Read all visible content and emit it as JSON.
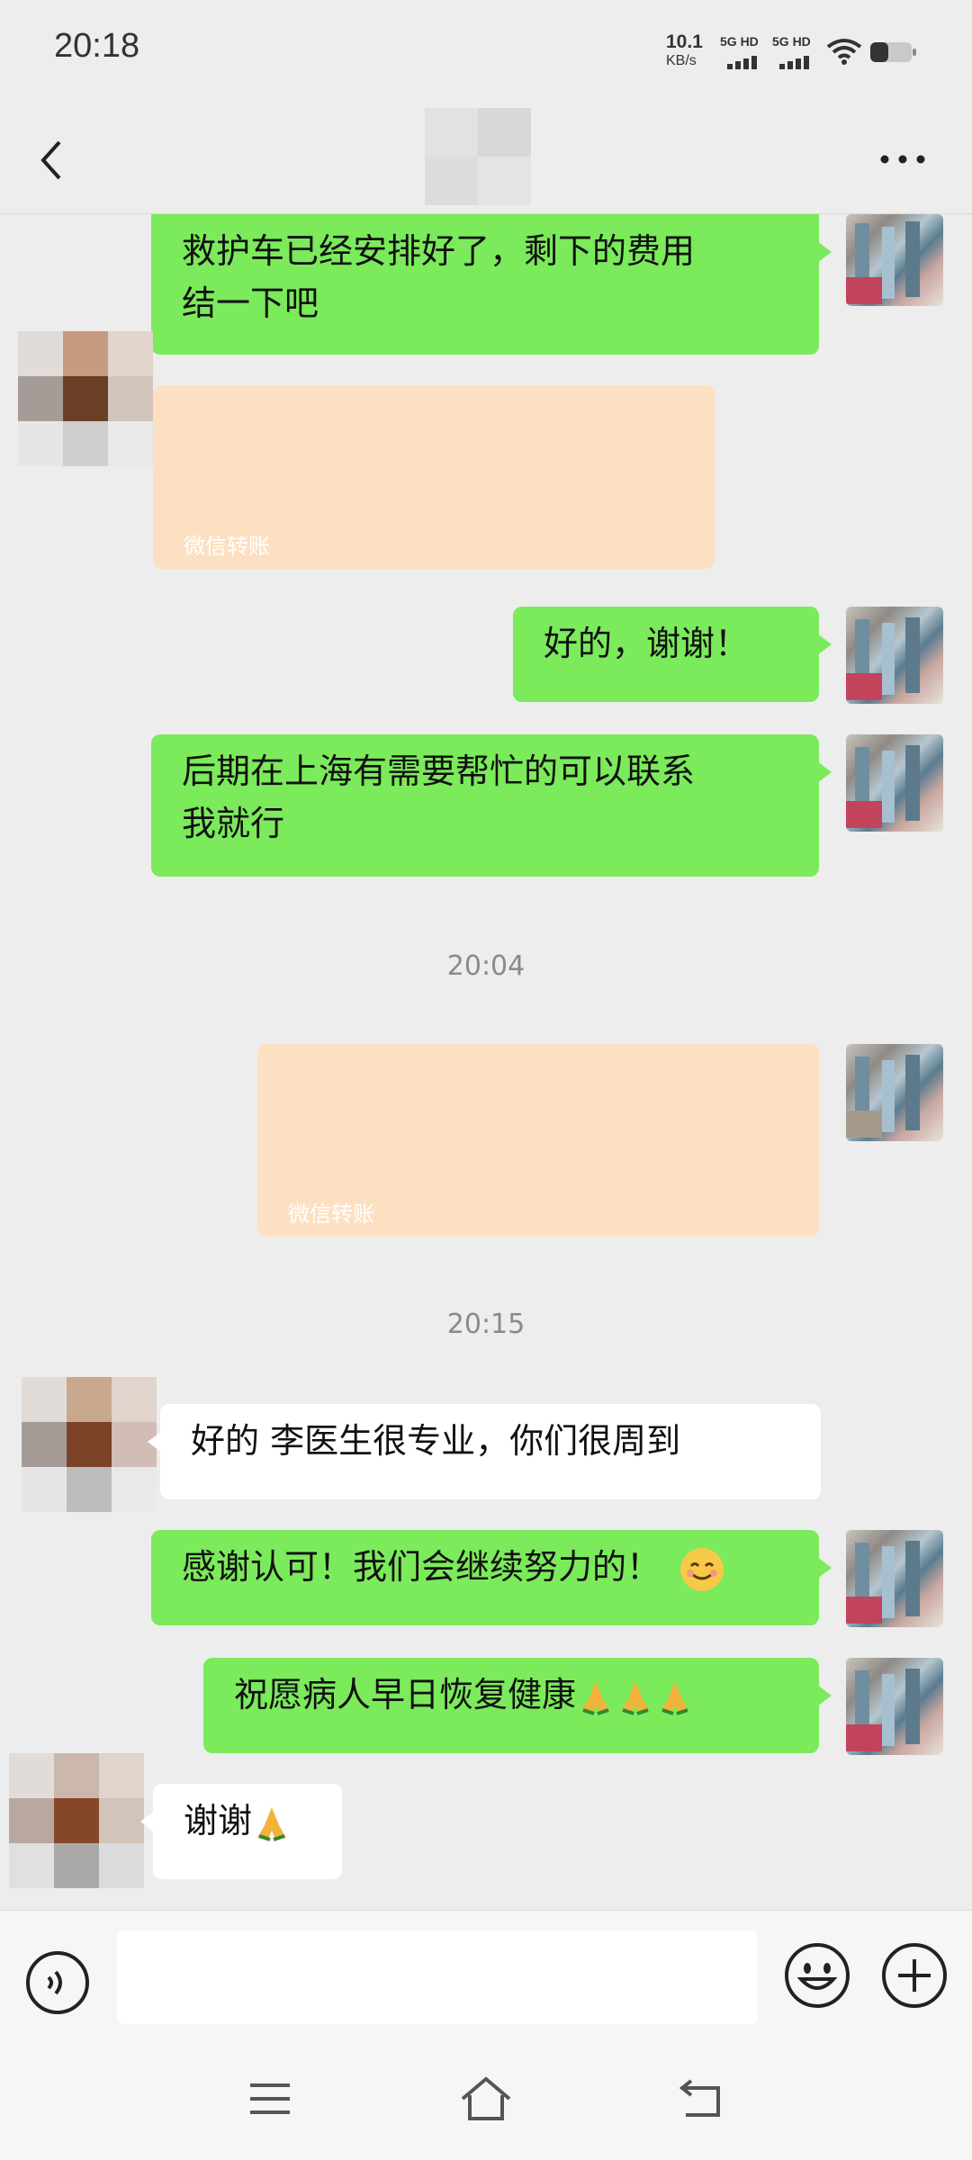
{
  "status_bar": {
    "time": "20:18",
    "net_speed": "10.1",
    "net_speed_unit": "KB/s",
    "sim1_label": "5G HD",
    "sim2_label": "5G HD"
  },
  "header": {
    "back_icon": "chevron-left-icon",
    "more_icon": "more-horizontal-icon"
  },
  "messages": [
    {
      "side": "me",
      "text_line1": "救护车已经安排好了，剩下的费用",
      "text_line2": "结一下吧"
    },
    {
      "side": "other",
      "type": "transfer",
      "label": "微信转账"
    },
    {
      "side": "me",
      "text": "好的，谢谢！"
    },
    {
      "side": "me",
      "text_line1": "后期在上海有需要帮忙的可以联系",
      "text_line2": "我就行"
    },
    {
      "side": "time",
      "text": "20:04"
    },
    {
      "side": "me",
      "type": "transfer",
      "label": "微信转账"
    },
    {
      "side": "time",
      "text": "20:15"
    },
    {
      "side": "other",
      "text": "好的 李医生很专业，你们很周到"
    },
    {
      "side": "me",
      "text": "感谢认可！我们会继续努力的！",
      "emoji": "smiling-face-icon"
    },
    {
      "side": "me",
      "text": "祝愿病人早日恢复健康",
      "emoji": "folded-hands-icon x3"
    },
    {
      "side": "other",
      "text": "谢谢",
      "emoji": "folded-hands-icon"
    }
  ],
  "input_bar": {
    "value": "",
    "voice_icon": "voice-icon",
    "emoji_icon": "emoji-icon",
    "plus_icon": "plus-circle-icon"
  },
  "system_nav": {
    "menu_icon": "menu-icon",
    "home_icon": "home-icon",
    "back_icon": "back-icon"
  },
  "colors": {
    "background": "#ededed",
    "my_bubble": "#7bea5b",
    "other_bubble": "#ffffff",
    "transfer_card": "#fde0c2",
    "timestamp_text": "#8a8a8a"
  }
}
